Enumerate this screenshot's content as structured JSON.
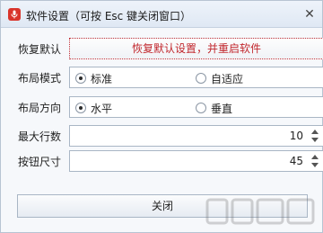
{
  "window": {
    "title": "软件设置（可按 Esc 键关闭窗口）",
    "close_glyph": "✕",
    "app_icon": "microphone-icon",
    "accent_color": "#d9342b"
  },
  "reset": {
    "label": "恢复默认",
    "button_label": "恢复默认设置，并重启软件"
  },
  "layout_mode": {
    "label": "布局模式",
    "options": [
      {
        "label": "标准",
        "selected": true
      },
      {
        "label": "自适应",
        "selected": false
      }
    ]
  },
  "layout_direction": {
    "label": "布局方向",
    "options": [
      {
        "label": "水平",
        "selected": true
      },
      {
        "label": "垂直",
        "selected": false
      }
    ]
  },
  "max_rows": {
    "label": "最大行数",
    "value": "10"
  },
  "button_size": {
    "label": "按钮尺寸",
    "value": "45"
  },
  "footer": {
    "close_label": "关闭"
  }
}
